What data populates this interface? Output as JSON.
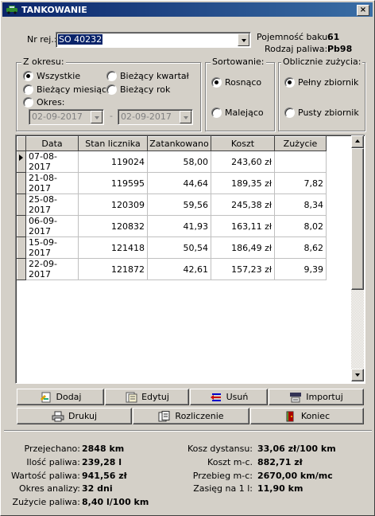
{
  "window": {
    "title": "TANKOWANIE",
    "close": "×"
  },
  "header": {
    "nr_label": "Nr rej.:",
    "nr_value": "SO 40232",
    "capacity_label": "Pojemność baku:",
    "capacity_value": "61",
    "fuel_label": "Rodzaj paliwa:",
    "fuel_value": "Pb98"
  },
  "period": {
    "title": "Z okresu:",
    "opt_all": "Wszystkie",
    "opt_quarter": "Bieżący kwartał",
    "opt_month": "Bieżący miesiąc",
    "opt_year": "Bieżący rok",
    "opt_range": "Okres:",
    "date_from": "02-09-2017",
    "dash": "-",
    "date_to": "02-09-2017"
  },
  "sort": {
    "title": "Sortowanie:",
    "asc": "Rosnąco",
    "desc": "Malejąco"
  },
  "calc": {
    "title": "Oblicznie zużycia:",
    "full": "Pełny zbiornik",
    "empty": "Pusty zbiornik"
  },
  "table": {
    "headers": [
      "Data",
      "Stan licznika",
      "Zatankowano",
      "Koszt",
      "Zużycie"
    ],
    "rows": [
      [
        "07-08-2017",
        "119024",
        "58,00",
        "243,60 zł",
        ""
      ],
      [
        "21-08-2017",
        "119595",
        "44,64",
        "189,35 zł",
        "7,82"
      ],
      [
        "25-08-2017",
        "120309",
        "59,56",
        "245,38 zł",
        "8,34"
      ],
      [
        "06-09-2017",
        "120832",
        "41,93",
        "163,11 zł",
        "8,02"
      ],
      [
        "15-09-2017",
        "121418",
        "50,54",
        "186,49 zł",
        "8,62"
      ],
      [
        "22-09-2017",
        "121872",
        "42,61",
        "157,23 zł",
        "9,39"
      ]
    ]
  },
  "buttons": {
    "add": "Dodaj",
    "edit": "Edytuj",
    "delete": "Usuń",
    "import": "Importuj",
    "print": "Drukuj",
    "settle": "Rozliczenie",
    "close": "Koniec"
  },
  "summary": {
    "distance_label": "Przejechano:",
    "distance_value": "2848 km",
    "fuel_label": "Ilość paliwa:",
    "fuel_value": "239,28 l",
    "fuel_cost_label": "Wartość paliwa:",
    "fuel_cost_value": "941,56 zł",
    "period_label": "Okres analizy:",
    "period_value": "32 dni",
    "consumption_label": "Zużycie paliwa:",
    "consumption_value": "8,40 l/100 km",
    "cost_dist_label": "Kosz dystansu:",
    "cost_dist_value": "33,06 zł/100 km",
    "cost_month_label": "Koszt m-c.",
    "cost_month_value": "882,71 zł",
    "mileage_month_label": "Przebieg m-c:",
    "mileage_month_value": "2670,00 km/mc",
    "range_label": "Zasięg na 1 l:",
    "range_value": "11,90 km"
  }
}
